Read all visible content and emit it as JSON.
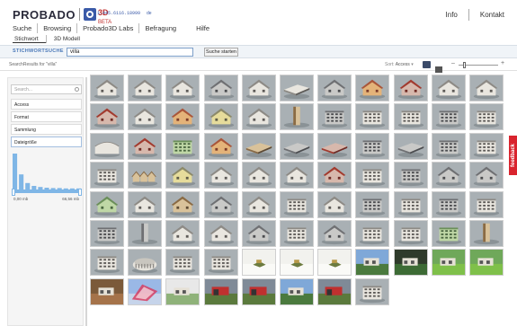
{
  "header": {
    "logo_word": "PROBADO",
    "logo_3d": "3D",
    "logo_beta": "BETA",
    "counter": "1.445.6116.18999",
    "lang": "de",
    "links": [
      "Info",
      "Kontakt"
    ]
  },
  "nav": {
    "items": [
      "Suche",
      "Browsing",
      "Probado3D Labs",
      "Befragung",
      "Hilfe"
    ],
    "sub": [
      "Stichwort",
      "3D Modell"
    ]
  },
  "search": {
    "label": "STICHWORTSUCHE",
    "value": "villa",
    "button": "Suche starten"
  },
  "results": {
    "label": "SearchResults for \"villa\"",
    "sort_label": "Sort:",
    "sort_value": "Access"
  },
  "filters": {
    "search_placeholder": "Search...",
    "facets": [
      "Access",
      "Format",
      "Sammlung",
      "Dateigröße"
    ],
    "histogram": [
      1.0,
      0.42,
      0.18,
      0.1,
      0.07,
      0.05,
      0.04,
      0.04,
      0.03,
      0.03,
      0.03
    ],
    "size_min": "0,00 mb",
    "size_max": "66,56 mb"
  },
  "feedback": "feedback",
  "colors": {
    "accent": "#3a5aa8",
    "feedback": "#d9242e",
    "slider": "#7fb6e6"
  },
  "grid": {
    "columns": 11,
    "rows": [
      [
        "house-white",
        "house-white",
        "house-white",
        "house-grey",
        "house-white",
        "shed-flat",
        "house-grey",
        "house-orange",
        "house-red",
        "house-white",
        "house-white"
      ],
      [
        "house-red",
        "house-white",
        "house-orange",
        "house-yellow",
        "house-white",
        "tower-tan",
        "block-grey",
        "block-white",
        "block-white",
        "block-grey",
        "block-white"
      ],
      [
        "hall-curved",
        "house-red",
        "block-green",
        "house-orange",
        "slab-tan",
        "slab-grey",
        "slab-red",
        "block-grey",
        "slab-grey",
        "block-grey",
        "block-white"
      ],
      [
        "block-white",
        "row-tan",
        "house-yellow",
        "house-white",
        "house-white",
        "house-white",
        "house-red",
        "block-white",
        "block-grey",
        "house-grey",
        "house-grey"
      ],
      [
        "house-green",
        "house-white",
        "house-tan",
        "house-grey",
        "house-white",
        "block-white",
        "house-white",
        "block-grey",
        "block-white",
        "block-grey",
        "block-white"
      ],
      [
        "block-grey",
        "tower-grey",
        "house-white",
        "house-white",
        "house-grey",
        "block-white",
        "house-grey",
        "block-white",
        "block-white",
        "block-green",
        "tower-tan"
      ],
      [
        "block-white",
        "rotunda",
        "block-white",
        "block-white",
        "photo-lawn",
        "photo-lawn",
        "photo-lawn",
        "photo-sky",
        "photo-dark",
        "photo-green",
        "photo-green"
      ],
      [
        "photo-brown",
        "photo-blue",
        "photo-white",
        "photo-red",
        "photo-red",
        "photo-sky",
        "photo-red",
        "block-white"
      ]
    ]
  }
}
